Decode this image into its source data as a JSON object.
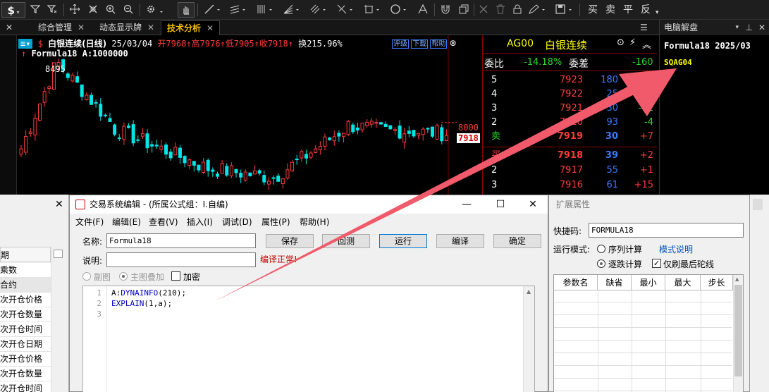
{
  "toolbar": {
    "icons": [
      "dollar-icon",
      "filter-icon",
      "clear-filter-icon",
      "move-icon",
      "crosshair-icon",
      "zoom-in-icon",
      "zoom-out-icon",
      "settings-icon",
      "hand-icon",
      "line-icon",
      "parallel-lines-icon",
      "bars-icon",
      "fan-icon",
      "multi-line-icon",
      "cross-line-icon",
      "rect-icon",
      "circle-icon",
      "text-icon",
      "magnet-icon",
      "layers-icon",
      "delete-icon",
      "trash-icon",
      "lock-icon",
      "pen-icon",
      "save-icon"
    ],
    "trade_buttons": [
      "买",
      "卖",
      "平",
      "反"
    ]
  },
  "tabs": [
    {
      "label": "综合管理",
      "active": false
    },
    {
      "label": "动态显示牌",
      "active": false
    },
    {
      "label": "技术分析",
      "active": true
    }
  ],
  "chart_header": {
    "symbol": "白银连续(日线)",
    "date": "25/03/04",
    "open": "开7968",
    "high": "高7976",
    "low": "低7905",
    "close": "收7918",
    "turnover": "换215.96%",
    "buttons": [
      "评级",
      "下载",
      "帮助"
    ],
    "formula": "Formula18",
    "formula_value": "A:1000000",
    "peak_label": "8495",
    "level_label": "8000",
    "last_price": "7918"
  },
  "chart_data": {
    "type": "candlestick",
    "title": "白银连续(日线)",
    "last": {
      "date": "25/03/04",
      "open": 7968,
      "high": 7976,
      "low": 7905,
      "close": 7918
    },
    "price_labels": [
      8495,
      8000,
      7918
    ],
    "colors": {
      "up": "#ff3b3b",
      "down": "#00e5e5"
    }
  },
  "book": {
    "code": "AG00",
    "name": "白银连续",
    "ratio_label": "委比",
    "ratio": "-14.18%",
    "diff_label": "委差",
    "diff": "-160",
    "asks": [
      {
        "level": "5",
        "price": "7923",
        "vol": "180",
        "chg": "+"
      },
      {
        "level": "4",
        "price": "7922",
        "vol": "25",
        "chg": "+31"
      },
      {
        "level": "3",
        "price": "7921",
        "vol": "30",
        "chg": "-12"
      },
      {
        "level": "2",
        "price": "7920",
        "vol": "93",
        "chg": "-4"
      },
      {
        "level": "卖",
        "price": "7919",
        "vol": "30",
        "chg": "+7"
      }
    ],
    "bids": [
      {
        "level": "买",
        "price": "7918",
        "vol": "39",
        "chg": "+2"
      },
      {
        "level": "2",
        "price": "7917",
        "vol": "55",
        "chg": "+1"
      },
      {
        "level": "3",
        "price": "7916",
        "vol": "61",
        "chg": "+15"
      }
    ]
  },
  "right_panel": {
    "title": "电脑解盘",
    "formula_line": "Formula18  2025/03",
    "code_line": "SQAG04"
  },
  "left_list": {
    "header": "期",
    "items": [
      "乘数",
      "合约",
      "次开仓价格",
      "次开仓数量",
      "次开仓时间",
      "次开仓日期",
      "次开仓价格",
      "次开仓数量",
      "次开仓时间"
    ]
  },
  "dialog": {
    "title": "交易系统编辑 - (所属公式组：I.自编)",
    "menus": [
      "文件(F)",
      "编辑(E)",
      "查看(V)",
      "插入(I)",
      "调试(D)",
      "属性(P)",
      "帮助(H)"
    ],
    "name_label": "名称:",
    "name_value": "Formula18",
    "desc_label": "说明:",
    "desc_value": "",
    "status": "编译正常!",
    "buttons": {
      "save": "保存",
      "backtest": "回测",
      "run": "运行",
      "compile": "编译",
      "ok": "确定"
    },
    "radio_sub": "副图",
    "radio_main": "主图叠加",
    "encrypt": "加密",
    "code_lines": [
      {
        "num": "1",
        "prefix": "A:",
        "kw": "DYNAINFO",
        "rest": "(210);"
      },
      {
        "num": "2",
        "prefix": "",
        "kw": "EXPLAIN",
        "rest": "(1,a);"
      },
      {
        "num": "3",
        "prefix": "",
        "kw": "",
        "rest": ""
      }
    ]
  },
  "ext": {
    "title": "扩展属性",
    "shortcut_label": "快捷码:",
    "shortcut_value": "FORMULA18",
    "mode_label": "运行模式:",
    "mode_series": "序列计算",
    "mode_help": "模式说明",
    "mode_tick": "逐跌计算",
    "last_only": "仅刷最后砣线",
    "columns": [
      "参数名",
      "缺省",
      "最小",
      "最大",
      "步长"
    ]
  }
}
